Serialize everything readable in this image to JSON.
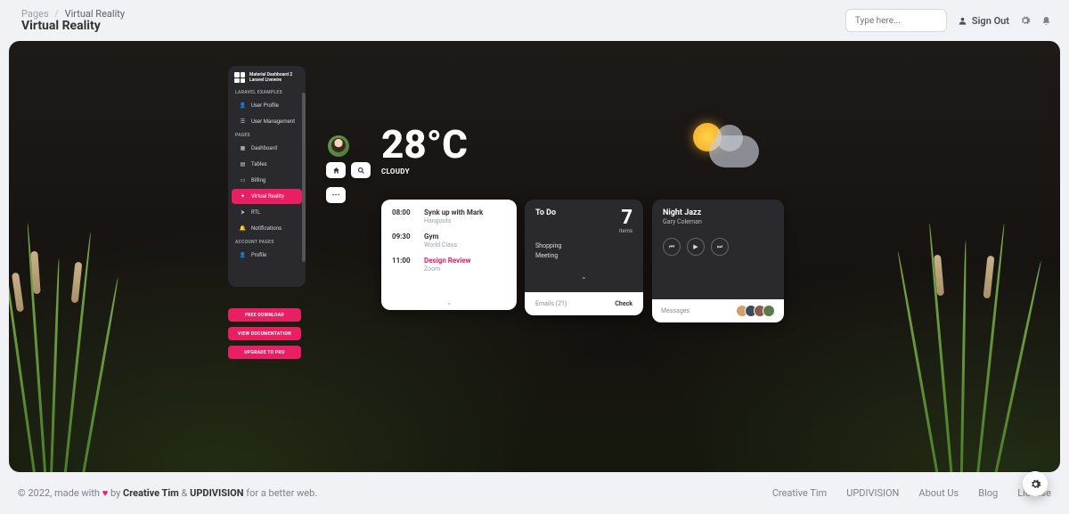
{
  "breadcrumb": {
    "root": "Pages",
    "current": "Virtual Reality"
  },
  "page_title": "Virtual Reality",
  "search_placeholder": "Type here...",
  "sign_out": "Sign Out",
  "sidebar": {
    "brand_line1": "Material Dashboard 2",
    "brand_line2": "Laravel Livewire",
    "sections": {
      "laravel": "LARAVEL EXAMPLES",
      "pages": "PAGES",
      "account": "ACCOUNT PAGES"
    },
    "items": {
      "user_profile": "User Profile",
      "user_mgmt": "User Management",
      "dashboard": "Dashboard",
      "tables": "Tables",
      "billing": "Billing",
      "vr": "Virtual Reality",
      "rtl": "RTL",
      "notifications": "Notifications",
      "profile": "Profile"
    },
    "buttons": {
      "download": "FREE DOWNLOAD",
      "docs": "VIEW DOCUMENTATION",
      "upgrade": "UPGRADE TO PRO"
    }
  },
  "weather": {
    "temp": "28°C",
    "condition": "CLOUDY"
  },
  "schedule": [
    {
      "time": "08:00",
      "title": "Synk up with Mark",
      "sub": "Hangouts",
      "pink": false
    },
    {
      "time": "09:30",
      "title": "Gym",
      "sub": "World Class",
      "pink": false
    },
    {
      "time": "11:00",
      "title": "Design Review",
      "sub": "Zoom",
      "pink": true
    }
  ],
  "todo": {
    "title": "To Do",
    "count": "7",
    "items_label": "items",
    "items": [
      "Shopping",
      "Meeting"
    ],
    "emails_label": "Emails (21)",
    "check": "Check"
  },
  "music": {
    "title": "Night Jazz",
    "artist": "Gary Coleman",
    "messages": "Messages"
  },
  "footer": {
    "copy_prefix": "© 2022, made with ",
    "copy_mid": " by ",
    "by1": "Creative Tim",
    "amp": " & ",
    "by2": "UPDIVISION",
    "copy_suffix": " for a better web.",
    "links": [
      "Creative Tim",
      "UPDIVISION",
      "About Us",
      "Blog",
      "License"
    ]
  }
}
